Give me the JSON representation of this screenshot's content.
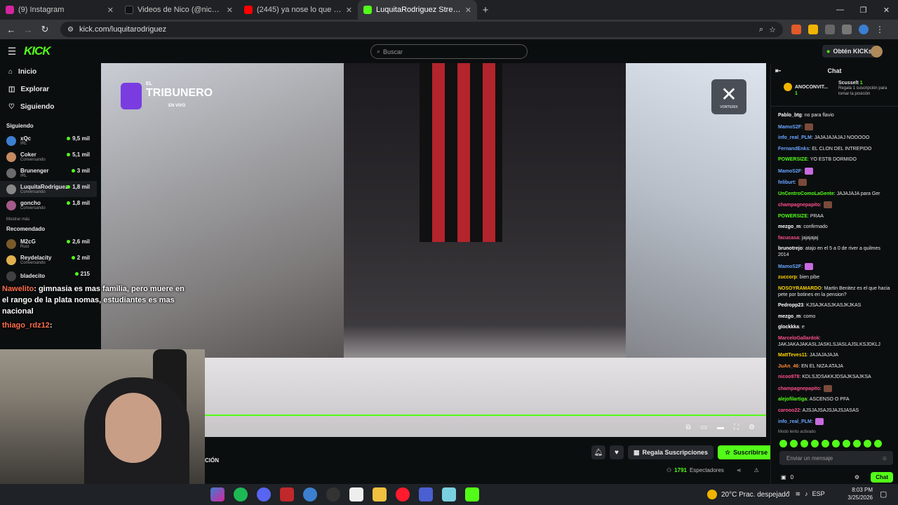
{
  "browser": {
    "tabs": [
      {
        "label": "(9) Instagram",
        "color": "#d6249f",
        "active": false
      },
      {
        "label": "Videos de Nico (@nicopaz1o) e",
        "color": "#111111",
        "active": false
      },
      {
        "label": "(2445) ya nose lo que esperar",
        "color": "#ff0000",
        "active": false
      },
      {
        "label": "LuquitaRodriguez Stream - Wat",
        "color": "#53fc18",
        "active": true
      }
    ],
    "url": "kick.com/luquitarodriguez"
  },
  "kick": {
    "logo": "KICK",
    "search_placeholder": "Buscar",
    "get_kicks": "Obtén KICKs"
  },
  "sidebar": {
    "nav": [
      {
        "label": "Inicio",
        "icon": "home-icon"
      },
      {
        "label": "Explorar",
        "icon": "compass-icon"
      },
      {
        "label": "Siguiendo",
        "icon": "heart-icon"
      }
    ],
    "following_title": "Siguiendo",
    "following": [
      {
        "name": "xQc",
        "sub": "IRL",
        "viewers": "9,5 mil",
        "color": "#3c7fd0"
      },
      {
        "name": "Coker",
        "sub": "Conversando",
        "viewers": "5,1 mil",
        "color": "#c48a60"
      },
      {
        "name": "Brunenger",
        "sub": "IRL",
        "viewers": "3 mil",
        "color": "#6a6a6a"
      },
      {
        "name": "LuquitaRodriguez",
        "sub": "Conversando",
        "viewers": "1,8 mil",
        "color": "#888888"
      },
      {
        "name": "goncho",
        "sub": "Conversando",
        "viewers": "1,8 mil",
        "color": "#a45a8a"
      }
    ],
    "show_more": "Mostrar más",
    "recommended_title": "Recomendado",
    "recommended": [
      {
        "name": "M2cG",
        "sub": "Rust",
        "viewers": "2,6 mil",
        "color": "#7a5a2a"
      },
      {
        "name": "Reydelacity",
        "sub": "Conversando",
        "viewers": "2 mil",
        "color": "#e0b050"
      },
      {
        "name": "bladecito",
        "sub": "",
        "viewers": "215",
        "color": "#404040"
      }
    ]
  },
  "video": {
    "logo_el": "EL",
    "logo_main": "TRIBUNERO",
    "logo_live": "EN VIVO",
    "vortex_mark": "✕",
    "vortex_text": "VORTERIX"
  },
  "overlay_chat": {
    "line1_user": "Nawelito",
    "line1_text": ": gimnasia es mas familia, pero muere en el rango de la plata nomas, estudiantes es mas nacional",
    "line2_user": "thiago_rdz12",
    "line2_text": ":"
  },
  "under_video": {
    "cion": "CIÓN",
    "gift_label": "Regala Suscripciones",
    "subscribe_label": "Suscribirse",
    "viewers_count": "1791",
    "viewers_label": "Espectadores"
  },
  "chat": {
    "title": "Chat",
    "pin1_name": "ANOCONVIT...",
    "pin1_count": "1",
    "pin2_name": "Scusselt",
    "pin2_count": "1",
    "pin2_text": "Regala 1 suscripción para tomar la posición",
    "messages": [
      {
        "user": "Pablo_btg",
        "color": "#ffffff",
        "text": " no para flavio",
        "emote": ""
      },
      {
        "user": "MamoS2F",
        "color": "#6aa5ff",
        "text": "",
        "emote": "#7a4a3a"
      },
      {
        "user": "info_real_PLM",
        "color": "#6aa5ff",
        "text": " JAJAJAJAJAJ NOOOOO",
        "emote": ""
      },
      {
        "user": "FernandEnks",
        "color": "#6aa5ff",
        "text": " EL CLON DEL INTREPIDO",
        "emote": ""
      },
      {
        "user": "POWERSIZE",
        "color": "#53fc18",
        "text": " YO ESTB DORMIDO",
        "emote": ""
      },
      {
        "user": "MamoS2F",
        "color": "#6aa5ff",
        "text": "",
        "emote": "#c86ae0"
      },
      {
        "user": "feliburt",
        "color": "#6aa5ff",
        "text": "",
        "emote": "#7a4a3a"
      },
      {
        "user": "UnCentroComoLaGente",
        "color": "#53fc18",
        "text": " JAJAJAJA para Ger",
        "emote": ""
      },
      {
        "user": "champagnepapito",
        "color": "#ff4f8a",
        "text": "",
        "emote": "#7a4a3a"
      },
      {
        "user": "POWERSIZE",
        "color": "#53fc18",
        "text": " PRAA",
        "emote": ""
      },
      {
        "user": "mezgo_m",
        "color": "#ffffff",
        "text": " confirmado",
        "emote": ""
      },
      {
        "user": "facucasa",
        "color": "#ff4f8a",
        "text": " jajajajaj",
        "emote": ""
      },
      {
        "user": "brunotrejo",
        "color": "#ffffff",
        "text": " atajo en el 5 a 0 de river a quilmes 2014",
        "emote": ""
      },
      {
        "user": "MamoS2F",
        "color": "#6aa5ff",
        "text": "",
        "emote": "#c86ae0"
      },
      {
        "user": "zuccorp",
        "color": "#ffd400",
        "text": " bien pibe",
        "emote": ""
      },
      {
        "user": "NOSOYRAMARDO",
        "color": "#ffd400",
        "text": " Martin Benitez es el que hacia pete por botines en la pension?",
        "emote": ""
      },
      {
        "user": "Pedropp23",
        "color": "#ffffff",
        "text": " KJSAJKASJKASJKJKAS",
        "emote": ""
      },
      {
        "user": "mezgo_m",
        "color": "#ffffff",
        "text": " como",
        "emote": ""
      },
      {
        "user": "glockkka",
        "color": "#ffffff",
        "text": " e",
        "emote": ""
      },
      {
        "user": "MarceloGallardok",
        "color": "#ff4f8a",
        "text": " JAKJAKAJAKASLJASKLSJASLAJSLKSJDKLJ",
        "emote": ""
      },
      {
        "user": "MattTeves11",
        "color": "#ffd400",
        "text": " JAJAJAJAJA",
        "emote": ""
      },
      {
        "user": "JuAn_46",
        "color": "#ff8a3a",
        "text": " EN EL NIZA ATAJA",
        "emote": ""
      },
      {
        "user": "nicoo978",
        "color": "#ff4f8a",
        "text": " KDLSJDSAKKJDSAJKSAJKSA",
        "emote": ""
      },
      {
        "user": "champagnepapito",
        "color": "#ff4f8a",
        "text": "",
        "emote": "#7a4a3a"
      },
      {
        "user": "alejofilartiga",
        "color": "#53fc18",
        "text": " ASCENSO O PFA",
        "emote": ""
      },
      {
        "user": "carooo22",
        "color": "#ff4f8a",
        "text": " AJSJAJSAJSJAJSJASAS",
        "emote": ""
      },
      {
        "user": "info_real_PLM",
        "color": "#6aa5ff",
        "text": "",
        "emote": "#c86ae0"
      }
    ],
    "slow_mode": "Modo lento activado",
    "input_placeholder": "Enviar un mensaje",
    "kicks": "0",
    "send_label": "Chat"
  },
  "taskbar": {
    "weather": "20°C  Prac. despejado",
    "lang": "ESP",
    "time": "8:03 PM",
    "date": "3/25/2026"
  }
}
